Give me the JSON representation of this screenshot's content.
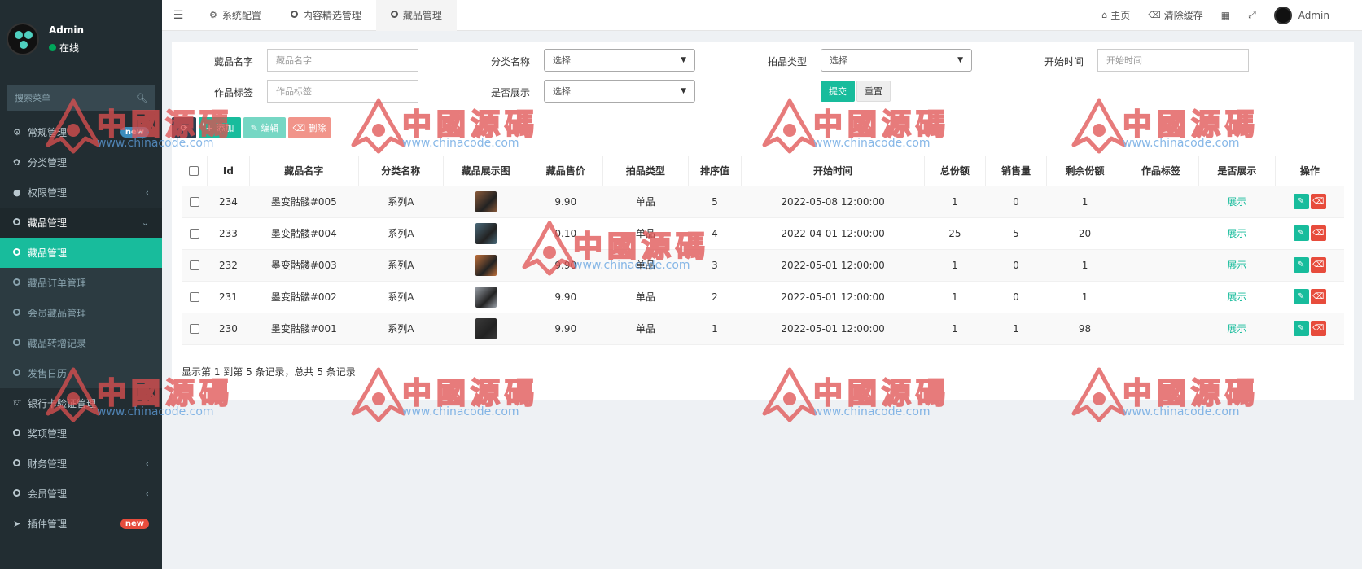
{
  "sidebar": {
    "user": {
      "name": "Admin",
      "status": "在线"
    },
    "search_placeholder": "搜索菜单",
    "items": [
      {
        "label": "常规管理",
        "icon": "cogs-icon",
        "badge": "new"
      },
      {
        "label": "分类管理",
        "icon": "leaf-icon"
      },
      {
        "label": "权限管理",
        "icon": "users-icon"
      },
      {
        "label": "藏品管理",
        "icon": "circle-icon"
      },
      {
        "label": "藏品管理",
        "icon": "circle-icon"
      },
      {
        "label": "藏品订单管理",
        "icon": "circle-icon"
      },
      {
        "label": "会员藏品管理",
        "icon": "circle-icon"
      },
      {
        "label": "藏品转增记录",
        "icon": "circle-icon"
      },
      {
        "label": "发售日历",
        "icon": "circle-icon"
      },
      {
        "label": "银行卡验证管理",
        "icon": "bank-icon"
      },
      {
        "label": "奖项管理",
        "icon": "circle-icon"
      },
      {
        "label": "财务管理",
        "icon": "circle-icon"
      },
      {
        "label": "会员管理",
        "icon": "circle-icon"
      },
      {
        "label": "插件管理",
        "icon": "rocket-icon",
        "badge": "new"
      }
    ]
  },
  "topbar": {
    "tabs": [
      {
        "label": "系统配置",
        "icon": "gear-icon"
      },
      {
        "label": "内容精选管理",
        "icon": "circle-icon"
      },
      {
        "label": "藏品管理",
        "icon": "circle-icon"
      }
    ],
    "home": "主页",
    "clear_cache": "清除缓存",
    "user": "Admin"
  },
  "filters": {
    "name_label": "藏品名字",
    "name_placeholder": "藏品名字",
    "category_label": "分类名称",
    "category_value": "选择",
    "auction_label": "拍品类型",
    "auction_value": "选择",
    "start_label": "开始时间",
    "start_placeholder": "开始时间",
    "tag_label": "作品标签",
    "tag_placeholder": "作品标签",
    "show_label": "是否展示",
    "show_value": "选择",
    "submit": "提交",
    "reset": "重置"
  },
  "toolbar": {
    "add": "添加",
    "edit": "编辑",
    "delete": "删除"
  },
  "table": {
    "headers": [
      "Id",
      "藏品名字",
      "分类名称",
      "藏品展示图",
      "藏品售价",
      "拍品类型",
      "排序值",
      "开始时间",
      "总份额",
      "销售量",
      "剩余份额",
      "作品标签",
      "是否展示",
      "操作"
    ],
    "rows": [
      {
        "id": "234",
        "name": "墨变骷髅#005",
        "cat": "系列A",
        "price": "9.90",
        "type": "单品",
        "sort": "5",
        "start": "2022-05-08 12:00:00",
        "total": "1",
        "sold": "0",
        "left": "1",
        "tag": "",
        "show": "展示",
        "thumb_color": "#8a5a3a"
      },
      {
        "id": "233",
        "name": "墨变骷髅#004",
        "cat": "系列A",
        "price": "0.10",
        "type": "单品",
        "sort": "4",
        "start": "2022-04-01 12:00:00",
        "total": "25",
        "sold": "5",
        "left": "20",
        "tag": "",
        "show": "展示",
        "thumb_color": "#4a6a7a"
      },
      {
        "id": "232",
        "name": "墨变骷髅#003",
        "cat": "系列A",
        "price": "9.90",
        "type": "单品",
        "sort": "3",
        "start": "2022-05-01 12:00:00",
        "total": "1",
        "sold": "0",
        "left": "1",
        "tag": "",
        "show": "展示",
        "thumb_color": "#c0703a"
      },
      {
        "id": "231",
        "name": "墨变骷髅#002",
        "cat": "系列A",
        "price": "9.90",
        "type": "单品",
        "sort": "2",
        "start": "2022-05-01 12:00:00",
        "total": "1",
        "sold": "0",
        "left": "1",
        "tag": "",
        "show": "展示",
        "thumb_color": "#9aa0a8"
      },
      {
        "id": "230",
        "name": "墨变骷髅#001",
        "cat": "系列A",
        "price": "9.90",
        "type": "单品",
        "sort": "1",
        "start": "2022-05-01 12:00:00",
        "total": "1",
        "sold": "1",
        "left": "98",
        "tag": "",
        "show": "展示",
        "thumb_color": "#3a3a3a"
      }
    ]
  },
  "pager_text": "显示第 1 到第 5 条记录，总共 5 条记录",
  "watermark": {
    "cn": "中國源碼",
    "url": "www.chinacode.com"
  },
  "colors": {
    "sidebar": "#222d32",
    "accent": "#18bc9c",
    "danger": "#e74c3c"
  }
}
